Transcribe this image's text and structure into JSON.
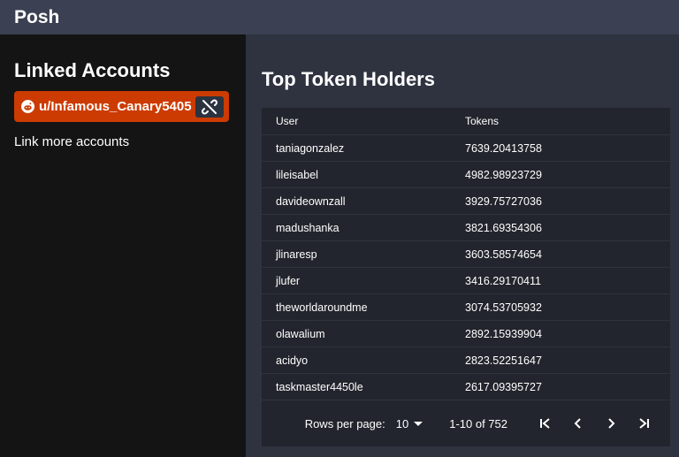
{
  "app": {
    "title": "Posh"
  },
  "sidebar": {
    "heading": "Linked Accounts",
    "account": {
      "username": "u/Infamous_Canary5405",
      "icon": "reddit-icon",
      "action_icon": "unlink-icon"
    },
    "link_more": "Link more accounts"
  },
  "main": {
    "title": "Top Token Holders",
    "columns": [
      "User",
      "Tokens"
    ],
    "rows": [
      {
        "user": "taniagonzalez",
        "tokens": "7639.20413758"
      },
      {
        "user": "lileisabel",
        "tokens": "4982.98923729"
      },
      {
        "user": "davideownzall",
        "tokens": "3929.75727036"
      },
      {
        "user": "madushanka",
        "tokens": "3821.69354306"
      },
      {
        "user": "jlinaresp",
        "tokens": "3603.58574654"
      },
      {
        "user": "jlufer",
        "tokens": "3416.29170411"
      },
      {
        "user": "theworldaroundme",
        "tokens": "3074.53705932"
      },
      {
        "user": "olawalium",
        "tokens": "2892.15939904"
      },
      {
        "user": "acidyo",
        "tokens": "2823.52251647"
      },
      {
        "user": "taskmaster4450le",
        "tokens": "2617.09395727"
      }
    ],
    "pagination": {
      "rows_per_page_label": "Rows per page:",
      "rows_per_page_value": "10",
      "range": "1-10 of 752"
    }
  },
  "colors": {
    "accent": "#cc3b02",
    "sidebar_bg": "#141414",
    "main_bg": "#2f3340",
    "table_bg": "#22252d"
  }
}
